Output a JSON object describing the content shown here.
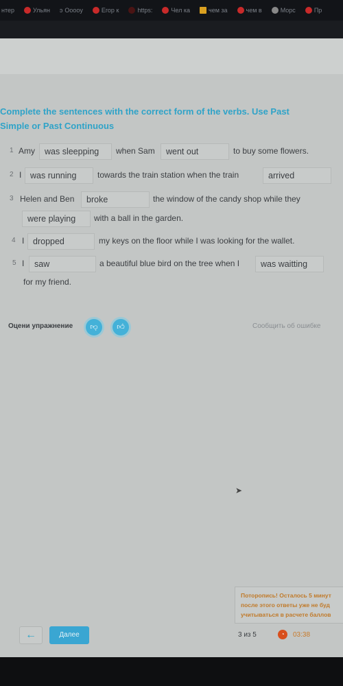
{
  "browser": {
    "bookmarks": [
      "нтер",
      "Ульян",
      "Ооооу",
      "Егор к",
      "https:",
      "Чел ка",
      "чем за",
      "чем в",
      "Морс",
      "Пр"
    ]
  },
  "exercise": {
    "title": "Complete the sentences with the correct form of the verbs. Use Past Simple or Past Continuous",
    "sentences": [
      {
        "num": "1",
        "parts": [
          "Amy",
          "when Sam",
          "to buy some flowers."
        ],
        "answers": [
          "was sleepping",
          "went out"
        ]
      },
      {
        "num": "2",
        "parts": [
          "I",
          "towards the train station when the train"
        ],
        "answers": [
          "was running",
          "arrived"
        ]
      },
      {
        "num": "3",
        "parts": [
          "Helen and Ben",
          "the window of the candy shop while they",
          "with a ball in the garden."
        ],
        "answers": [
          "broke",
          "were playing"
        ]
      },
      {
        "num": "4",
        "parts": [
          "I",
          "my keys on the floor while I was looking for the wallet."
        ],
        "answers": [
          "dropped"
        ]
      },
      {
        "num": "5",
        "parts": [
          "I",
          "a beautiful blue bird on the tree when I",
          "for my friend."
        ],
        "answers": [
          "saw",
          "was waitting"
        ]
      }
    ]
  },
  "feedback": {
    "rate_label": "Оцени упражнение",
    "report_label": "Сообщить об ошибке",
    "dislike_icon": "thumbs-down-icon",
    "like_icon": "thumbs-up-icon"
  },
  "warning": {
    "lines": [
      "Поторопись! Осталось 5 минут",
      "после этого ответы уже не буд",
      "учитываться в расчете баллов"
    ]
  },
  "footer": {
    "back_icon": "←",
    "next_label": "Далее",
    "counter": "3 из 5",
    "timer": "03:38"
  },
  "colors": {
    "accent": "#3aa6d2",
    "title": "#2fa3c8",
    "timer": "#d84f1d"
  }
}
